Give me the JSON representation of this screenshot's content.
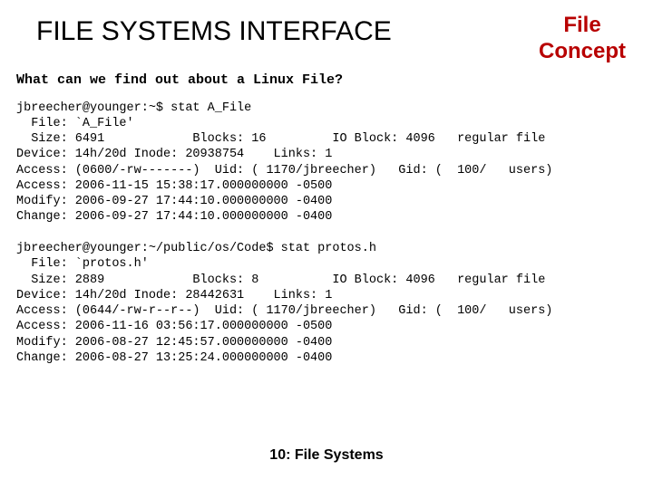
{
  "header": {
    "title": "FILE SYSTEMS INTERFACE",
    "concept_line1": "File",
    "concept_line2": "Concept"
  },
  "question": "What can we find out about a Linux File?",
  "terminal": "jbreecher@younger:~$ stat A_File\n  File: `A_File'\n  Size: 6491            Blocks: 16         IO Block: 4096   regular file\nDevice: 14h/20d Inode: 20938754    Links: 1\nAccess: (0600/-rw-------)  Uid: ( 1170/jbreecher)   Gid: (  100/   users)\nAccess: 2006-11-15 15:38:17.000000000 -0500\nModify: 2006-09-27 17:44:10.000000000 -0400\nChange: 2006-09-27 17:44:10.000000000 -0400\n\njbreecher@younger:~/public/os/Code$ stat protos.h\n  File: `protos.h'\n  Size: 2889            Blocks: 8          IO Block: 4096   regular file\nDevice: 14h/20d Inode: 28442631    Links: 1\nAccess: (0644/-rw-r--r--)  Uid: ( 1170/jbreecher)   Gid: (  100/   users)\nAccess: 2006-11-16 03:56:17.000000000 -0500\nModify: 2006-08-27 12:45:57.000000000 -0400\nChange: 2006-08-27 13:25:24.000000000 -0400",
  "footer": "10: File Systems"
}
